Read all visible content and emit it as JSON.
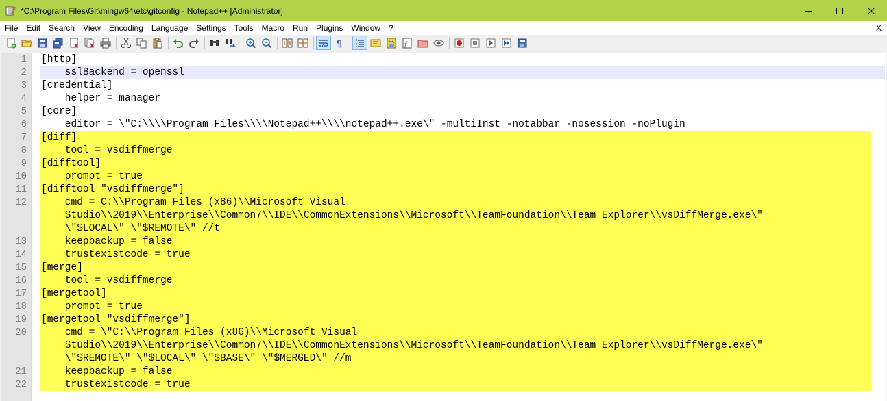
{
  "window": {
    "title": "*C:\\Program Files\\Git\\mingw64\\etc\\gitconfig - Notepad++ [Administrator]",
    "colors": {
      "titlebar": "#b1d34a",
      "highlight": "#ffff55",
      "current_line": "#e8e8ff"
    }
  },
  "menu": {
    "items": [
      "File",
      "Edit",
      "Search",
      "View",
      "Encoding",
      "Language",
      "Settings",
      "Tools",
      "Macro",
      "Run",
      "Plugins",
      "Window",
      "?"
    ],
    "close_label": "X"
  },
  "toolbar": {
    "icons": [
      "new-file-icon",
      "open-file-icon",
      "save-icon",
      "save-all-icon",
      "close-icon",
      "close-all-icon",
      "print-icon",
      "|",
      "cut-icon",
      "copy-icon",
      "paste-icon",
      "|",
      "undo-icon",
      "redo-icon",
      "|",
      "find-icon",
      "replace-icon",
      "|",
      "zoom-in-icon",
      "zoom-out-icon",
      "|",
      "sync-vertical-icon",
      "sync-horizontal-icon",
      "|",
      "word-wrap-icon",
      "show-all-chars-icon",
      "|",
      "indent-guide-icon",
      "language-icon",
      "document-map-icon",
      "function-list-icon",
      "folder-workspace-icon",
      "monitoring-icon",
      "|",
      "record-macro-icon",
      "stop-record-icon",
      "play-macro-icon",
      "play-macro-multiple-icon",
      "save-macro-icon"
    ]
  },
  "editor": {
    "caret": {
      "line": 2,
      "column": 14
    },
    "rows": [
      {
        "num": "1",
        "text": "[http]",
        "style": "normal"
      },
      {
        "num": "2",
        "text": "    sslBackend = openssl",
        "style": "current"
      },
      {
        "num": "3",
        "text": "[credential]",
        "style": "normal"
      },
      {
        "num": "4",
        "text": "    helper = manager",
        "style": "normal"
      },
      {
        "num": "5",
        "text": "[core]",
        "style": "normal"
      },
      {
        "num": "6",
        "text": "    editor = \\\"C:\\\\\\\\Program Files\\\\\\\\Notepad++\\\\\\\\notepad++.exe\\\" -multiInst -notabbar -nosession -noPlugin",
        "style": "normal"
      },
      {
        "num": "7",
        "text": "[diff]",
        "style": "hl"
      },
      {
        "num": "8",
        "text": "    tool = vsdiffmerge",
        "style": "hl"
      },
      {
        "num": "9",
        "text": "[difftool]",
        "style": "hl"
      },
      {
        "num": "10",
        "text": "    prompt = true",
        "style": "hl"
      },
      {
        "num": "11",
        "text": "[difftool \"vsdiffmerge\"]",
        "style": "hl"
      },
      {
        "num": "12",
        "text": "    cmd = C:\\\\Program Files (x86)\\\\Microsoft Visual",
        "style": "hl"
      },
      {
        "num": "",
        "text": "    Studio\\\\2019\\\\Enterprise\\\\Common7\\\\IDE\\\\CommonExtensions\\\\Microsoft\\\\TeamFoundation\\\\Team Explorer\\\\vsDiffMerge.exe\\\"",
        "style": "hl"
      },
      {
        "num": "",
        "text": "    \\\"$LOCAL\\\" \\\"$REMOTE\\\" //t",
        "style": "hl"
      },
      {
        "num": "13",
        "text": "    keepbackup = false",
        "style": "hl"
      },
      {
        "num": "14",
        "text": "    trustexistcode = true",
        "style": "hl"
      },
      {
        "num": "15",
        "text": "[merge]",
        "style": "hl"
      },
      {
        "num": "16",
        "text": "    tool = vsdiffmerge",
        "style": "hl"
      },
      {
        "num": "17",
        "text": "[mergetool]",
        "style": "hl"
      },
      {
        "num": "18",
        "text": "    prompt = true",
        "style": "hl"
      },
      {
        "num": "19",
        "text": "[mergetool \"vsdiffmerge\"]",
        "style": "hl"
      },
      {
        "num": "20",
        "text": "    cmd = \\\"C:\\\\Program Files (x86)\\\\Microsoft Visual",
        "style": "hl"
      },
      {
        "num": "",
        "text": "    Studio\\\\2019\\\\Enterprise\\\\Common7\\\\IDE\\\\CommonExtensions\\\\Microsoft\\\\TeamFoundation\\\\Team Explorer\\\\vsDiffMerge.exe\\\"",
        "style": "hl"
      },
      {
        "num": "",
        "text": "    \\\"$REMOTE\\\" \\\"$LOCAL\\\" \\\"$BASE\\\" \\\"$MERGED\\\" //m",
        "style": "hl"
      },
      {
        "num": "21",
        "text": "    keepbackup = false",
        "style": "hl"
      },
      {
        "num": "22",
        "text": "    trustexistcode = true",
        "style": "hl"
      }
    ]
  }
}
